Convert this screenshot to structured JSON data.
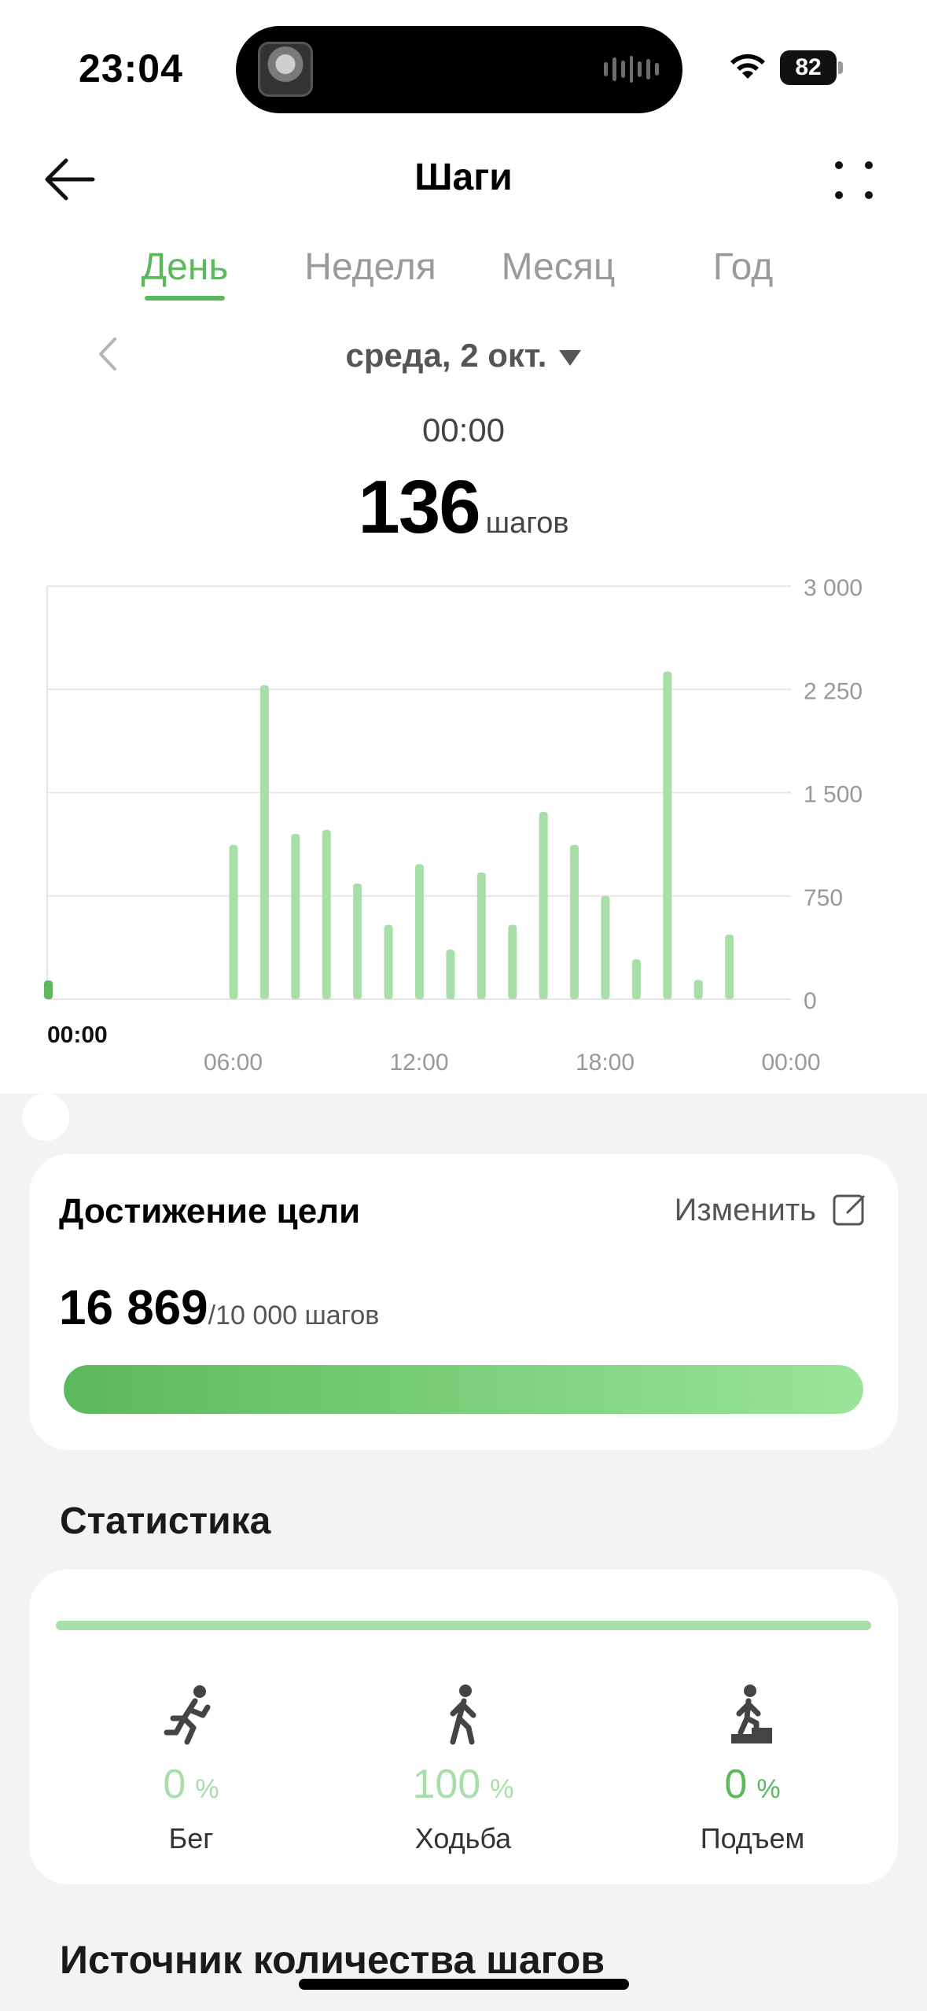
{
  "status": {
    "time": "23:04",
    "battery": "82"
  },
  "header": {
    "title": "Шаги",
    "back_icon": "arrow-left-icon",
    "more_icon": "more-icon"
  },
  "tabs": [
    {
      "label": "День",
      "active": true
    },
    {
      "label": "Неделя",
      "active": false
    },
    {
      "label": "Месяц",
      "active": false
    },
    {
      "label": "Год",
      "active": false
    }
  ],
  "date": {
    "label": "среда, 2 окт."
  },
  "selection": {
    "time": "00:00",
    "steps": "136",
    "unit": "шагов"
  },
  "chart_data": {
    "type": "bar",
    "selected_label": "00:00",
    "x_ticks": [
      "06:00",
      "12:00",
      "18:00",
      "00:00"
    ],
    "y_ticks": [
      "3 000",
      "2 250",
      "1 500",
      "750",
      "0"
    ],
    "ylim": [
      0,
      3000
    ],
    "hours": [
      0,
      6,
      7,
      8,
      9,
      10,
      11,
      12,
      13,
      14,
      15,
      16,
      17,
      18,
      19,
      20,
      21,
      22
    ],
    "values": [
      136,
      1120,
      2280,
      1200,
      1230,
      840,
      540,
      980,
      360,
      920,
      540,
      1360,
      1120,
      750,
      290,
      2380,
      140,
      470
    ],
    "colors": {
      "bar": "#a8dea8",
      "selected": "#5cb85c",
      "grid": "#e5e5e5",
      "axis_text": "#999999"
    }
  },
  "goal": {
    "title": "Достижение цели",
    "edit_label": "Изменить",
    "value": "16 869",
    "target": "/10 000 шагов",
    "progress": 1.0
  },
  "stats": {
    "heading": "Статистика",
    "items": [
      {
        "icon": "running-icon",
        "value": "0",
        "unit": "%",
        "label": "Бег"
      },
      {
        "icon": "walking-icon",
        "value": "100",
        "unit": "%",
        "label": "Ходьба"
      },
      {
        "icon": "climbing-icon",
        "value": "0",
        "unit": "%",
        "label": "Подъем"
      }
    ]
  },
  "source": {
    "heading": "Источник количества шагов"
  }
}
